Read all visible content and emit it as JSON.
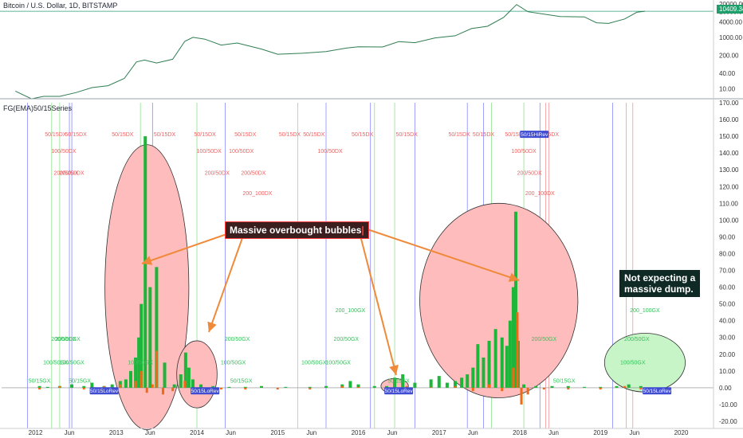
{
  "header": {
    "symbol_title": "Bitcoin / U.S. Dollar, 1D, BITSTAMP",
    "indicator_title": "FG(EMA)50/15Series",
    "last_price": "10409.34"
  },
  "annotations": {
    "callout_text": "Massive overbought bubbles",
    "note_line1": "Not expecting a",
    "note_line2": "massive dump."
  },
  "colors": {
    "price_line": "#2f7d52",
    "green_hist": "#1db53a",
    "orange_hist": "#f06a15",
    "red_ellipse_fill": "#ffbcbc",
    "green_ellipse_fill": "#c8f5c8",
    "arrow": "#ef8a3a",
    "marker_red": "#f06060",
    "marker_green": "#34c25a",
    "vline_blue": "#6b6bff",
    "vline_green": "#7fe07f",
    "badge_blue": "#3f4bd1"
  },
  "chart_data": [
    {
      "type": "line",
      "title": "Bitcoin / U.S. Dollar, 1D, BITSTAMP",
      "scale": "log",
      "ylim": [
        5,
        20000
      ],
      "yticks": [
        20000,
        10000,
        4000,
        1000,
        200,
        40,
        10
      ],
      "ytick_labels": [
        "20000.00",
        "10000.00",
        "4000.00",
        "1000.00",
        "200.00",
        "40.00",
        "10.00"
      ],
      "x": [
        2011.75,
        2011.95,
        2012.1,
        2012.3,
        2012.5,
        2012.7,
        2012.9,
        2013.1,
        2013.25,
        2013.35,
        2013.5,
        2013.7,
        2013.85,
        2013.95,
        2014.1,
        2014.3,
        2014.5,
        2014.8,
        2015.0,
        2015.3,
        2015.6,
        2015.85,
        2016.0,
        2016.3,
        2016.5,
        2016.7,
        2016.95,
        2017.2,
        2017.4,
        2017.6,
        2017.8,
        2017.96,
        2018.1,
        2018.3,
        2018.5,
        2018.8,
        2018.95,
        2019.1,
        2019.3,
        2019.45,
        2019.55
      ],
      "y": [
        8,
        4,
        5,
        5,
        7,
        11,
        13,
        25,
        110,
        130,
        100,
        140,
        700,
        1000,
        850,
        500,
        600,
        350,
        220,
        240,
        280,
        380,
        430,
        420,
        680,
        620,
        950,
        1150,
        2200,
        2700,
        6000,
        19000,
        10000,
        8000,
        6500,
        6300,
        3700,
        3500,
        5200,
        9500,
        10409.34
      ]
    },
    {
      "type": "bar",
      "title": "FG(EMA)50/15Series",
      "ylim": [
        -20,
        170
      ],
      "yticks": [
        170,
        160,
        150,
        140,
        130,
        120,
        110,
        100,
        90,
        80,
        70,
        60,
        50,
        40,
        30,
        20,
        10,
        0,
        -10,
        -20
      ],
      "ytick_labels": [
        "170.00",
        "160.00",
        "150.00",
        "140.00",
        "130.00",
        "120.00",
        "110.00",
        "100.00",
        "90.00",
        "80.00",
        "70.00",
        "60.00",
        "50.00",
        "40.00",
        "30.00",
        "20.00",
        "10.00",
        "0.00",
        "-10.00",
        "-20.00"
      ],
      "series": [
        {
          "x": [
            2012.05,
            2012.15,
            2012.3,
            2012.45,
            2012.6,
            2012.7,
            2012.85,
            2012.95,
            2013.05,
            2013.12,
            2013.18,
            2013.24,
            2013.28,
            2013.31,
            2013.36,
            2013.42,
            2013.5,
            2013.6,
            2013.72,
            2013.8,
            2013.86,
            2013.9,
            2013.95,
            2014.05,
            2014.2,
            2014.4,
            2014.6,
            2014.8,
            2015.1,
            2015.4,
            2015.6,
            2015.8,
            2015.9,
            2016.0,
            2016.2,
            2016.35,
            2016.45,
            2016.55,
            2016.7,
            2016.9,
            2017.0,
            2017.1,
            2017.2,
            2017.28,
            2017.35,
            2017.42,
            2017.48,
            2017.55,
            2017.62,
            2017.7,
            2017.78,
            2017.84,
            2017.88,
            2017.92,
            2017.95,
            2017.98,
            2018.05,
            2018.2,
            2018.4,
            2018.6,
            2018.8,
            2019.0,
            2019.2,
            2019.35,
            2019.5
          ],
          "values": [
            1,
            0.5,
            1,
            2,
            1,
            3,
            1,
            2,
            4,
            5,
            10,
            18,
            30,
            50,
            150,
            60,
            72,
            15,
            2,
            8,
            21,
            12,
            5,
            2,
            1,
            0.5,
            0.5,
            1,
            0.5,
            0.5,
            1,
            2,
            4,
            2,
            1,
            1,
            6,
            8,
            3,
            5,
            7,
            3,
            4,
            6,
            8,
            12,
            26,
            18,
            28,
            35,
            30,
            25,
            40,
            60,
            105,
            28,
            2,
            1,
            1,
            1,
            0.5,
            0.5,
            1,
            2,
            1
          ]
        },
        {
          "x": [
            2012.05,
            2012.3,
            2012.6,
            2012.85,
            2013.05,
            2013.24,
            2013.31,
            2013.38,
            2013.45,
            2013.5,
            2013.58,
            2013.7,
            2013.85,
            2013.95,
            2014.05,
            2014.3,
            2014.6,
            2015.0,
            2015.4,
            2015.8,
            2016.0,
            2016.4,
            2016.6,
            2016.9,
            2017.2,
            2017.42,
            2017.62,
            2017.78,
            2017.92,
            2017.97,
            2018.02,
            2018.1,
            2018.3,
            2018.6,
            2019.0,
            2019.3,
            2019.5
          ],
          "values": [
            -1,
            1,
            -1,
            1,
            2,
            4,
            10,
            -3,
            2,
            22,
            -4,
            -2,
            4,
            -2,
            -2,
            -1,
            -1,
            -1,
            -1,
            1,
            0.5,
            -1,
            1,
            0.5,
            1,
            -2,
            2,
            -2,
            12,
            45,
            -10,
            -4,
            -1,
            -1,
            -1,
            1,
            -1
          ]
        }
      ],
      "markers": {
        "red": [
          "50/15DX",
          "100/50DX",
          "200/50DX",
          "200/100DX",
          "200_100DX"
        ],
        "green": [
          "50/15GX",
          "100/50GX",
          "200/50GX",
          "200_100GX"
        ],
        "badges": [
          "50/15LoRev",
          "50/15HiRev"
        ]
      }
    }
  ],
  "x_axis": {
    "ticks": [
      "2012",
      "Jun",
      "2013",
      "Jun",
      "2014",
      "Jun",
      "2015",
      "Jun",
      "2016",
      "Jun",
      "2017",
      "Jun",
      "2018",
      "Jun",
      "2019",
      "Jun",
      "2020"
    ]
  }
}
